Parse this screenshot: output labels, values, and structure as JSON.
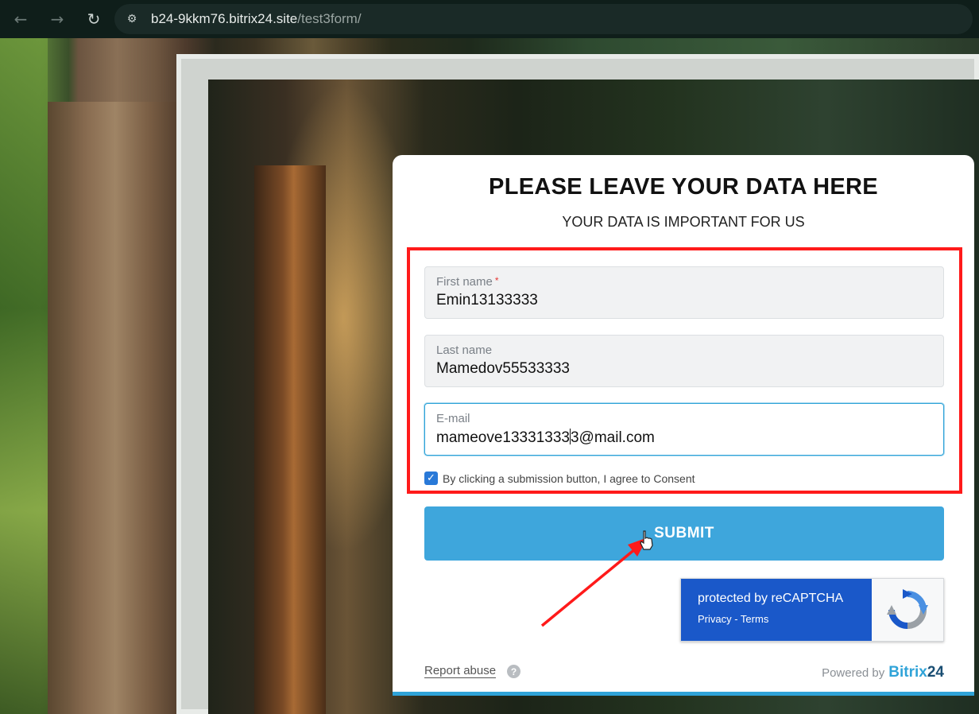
{
  "browser": {
    "back_icon": "arrow-left-icon",
    "forward_icon": "arrow-right-icon",
    "reload_icon": "reload-icon",
    "site_info_icon": "tune-icon",
    "url_host": "b24-9kkm76.bitrix24.site",
    "url_path": "/test3form/"
  },
  "form": {
    "title": "PLEASE LEAVE YOUR DATA HERE",
    "subtitle": "YOUR DATA IS IMPORTANT FOR US",
    "fields": [
      {
        "label": "First name",
        "required_mark": "*",
        "value": "Emin13133333"
      },
      {
        "label": "Last name",
        "value": "Mamedov55533333"
      },
      {
        "label": "E-mail",
        "value_before_caret": "mameove13331333",
        "value_after_caret": "3@mail.com"
      }
    ],
    "consent": {
      "checked": true,
      "text": "By clicking a submission button, I agree to Consent"
    },
    "submit_label": "SUBMIT",
    "recaptcha": {
      "title": "protected by reCAPTCHA",
      "links": "Privacy - Terms"
    },
    "report_abuse": "Report abuse",
    "help_glyph": "?",
    "powered_by": "Powered by",
    "brand_name": "Bitrix",
    "brand_number": "24"
  },
  "colors": {
    "accent": "#3ea6dc",
    "highlight": "#ff1a1a",
    "recaptcha_blue": "#1a58c9"
  }
}
